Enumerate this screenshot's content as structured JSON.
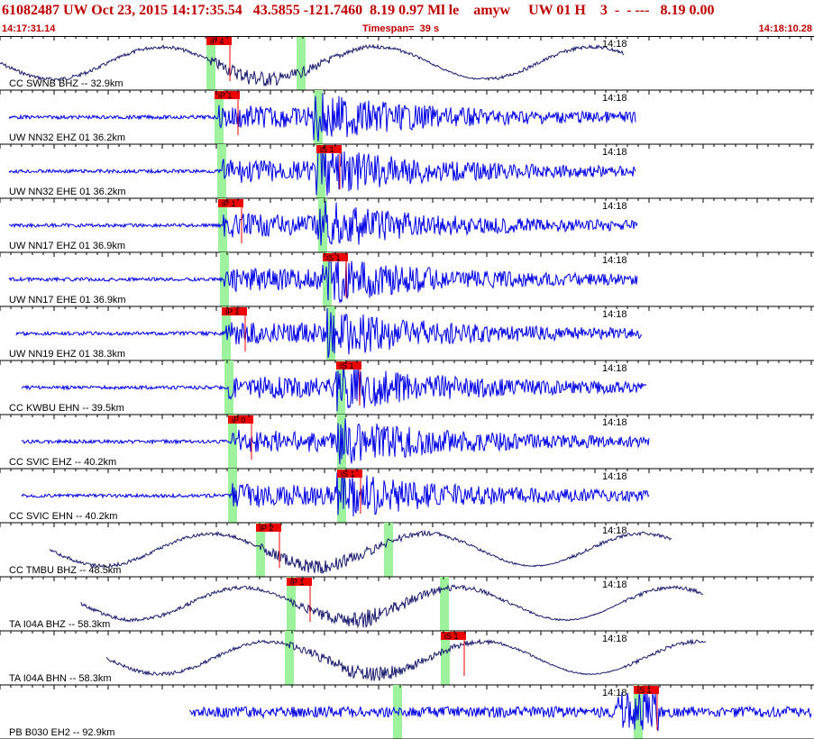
{
  "header": {
    "event_line": "61082487 UW Oct 23, 2015 14:17:35.54   43.5855 -121.7460  8.19 0.97 Ml le    amyw     UW 01 H    3  -  - ---   8.19 0.00",
    "start_time": "14:17:31.14",
    "timespan": "Timespan=  39 s",
    "end_time": "14:18:10.28"
  },
  "colors": {
    "header_text": "#c00000",
    "trace_blue": "#0000e6",
    "trace_dark": "#1a1a6e",
    "pick_flag": "#ee0000",
    "pick_window": "#9ef29e",
    "grid": "#000000"
  },
  "time_tick_label": "14:18",
  "traces": [
    {
      "label": "CC SWNB BHZ -- 32.9km",
      "pick1": "iP 4",
      "pick2": "",
      "style": "dark",
      "wave": "slow"
    },
    {
      "label": "UW NN32 EHZ 01 36.2km",
      "pick1": "iP 1",
      "pick2": "",
      "style": "blue",
      "wave": "fast"
    },
    {
      "label": "UW NN32 EHE 01 36.2km",
      "pick1": "",
      "pick2": "iS 1",
      "style": "blue",
      "wave": "fast"
    },
    {
      "label": "UW NN17 EHZ 01 36.9km",
      "pick1": "iP 1",
      "pick2": "",
      "style": "blue",
      "wave": "fast"
    },
    {
      "label": "UW NN17 EHE 01 36.9km",
      "pick1": "",
      "pick2": "iS 1",
      "style": "blue",
      "wave": "fast"
    },
    {
      "label": "UW NN19 EHZ 01 38.3km",
      "pick1": "iP 1",
      "pick2": "",
      "style": "blue",
      "wave": "fast"
    },
    {
      "label": "CC KWBU EHN -- 39.5km",
      "pick1": "",
      "pick2": "iS 1",
      "style": "blue",
      "wave": "fast"
    },
    {
      "label": "CC SVIC EHZ -- 40.2km",
      "pick1": "iP 0",
      "pick2": "",
      "style": "blue",
      "wave": "fast"
    },
    {
      "label": "CC SVIC EHN -- 40.2km",
      "pick1": "",
      "pick2": "iS 1",
      "style": "blue",
      "wave": "fast"
    },
    {
      "label": "CC TMBU BHZ -- 48.5km",
      "pick1": "iP 2",
      "pick2": "",
      "style": "dark",
      "wave": "slow"
    },
    {
      "label": "TA I04A BHZ -- 58.3km",
      "pick1": "iP 1",
      "pick2": "",
      "style": "dark",
      "wave": "slow"
    },
    {
      "label": "TA I04A BHN -- 58.3km",
      "pick1": "",
      "pick2": "iS 1",
      "style": "dark",
      "wave": "slow"
    },
    {
      "label": "PB B030 EH2 -- 92.9km",
      "pick1": "",
      "pick2": "iS 1",
      "style": "blue",
      "wave": "noise"
    }
  ]
}
